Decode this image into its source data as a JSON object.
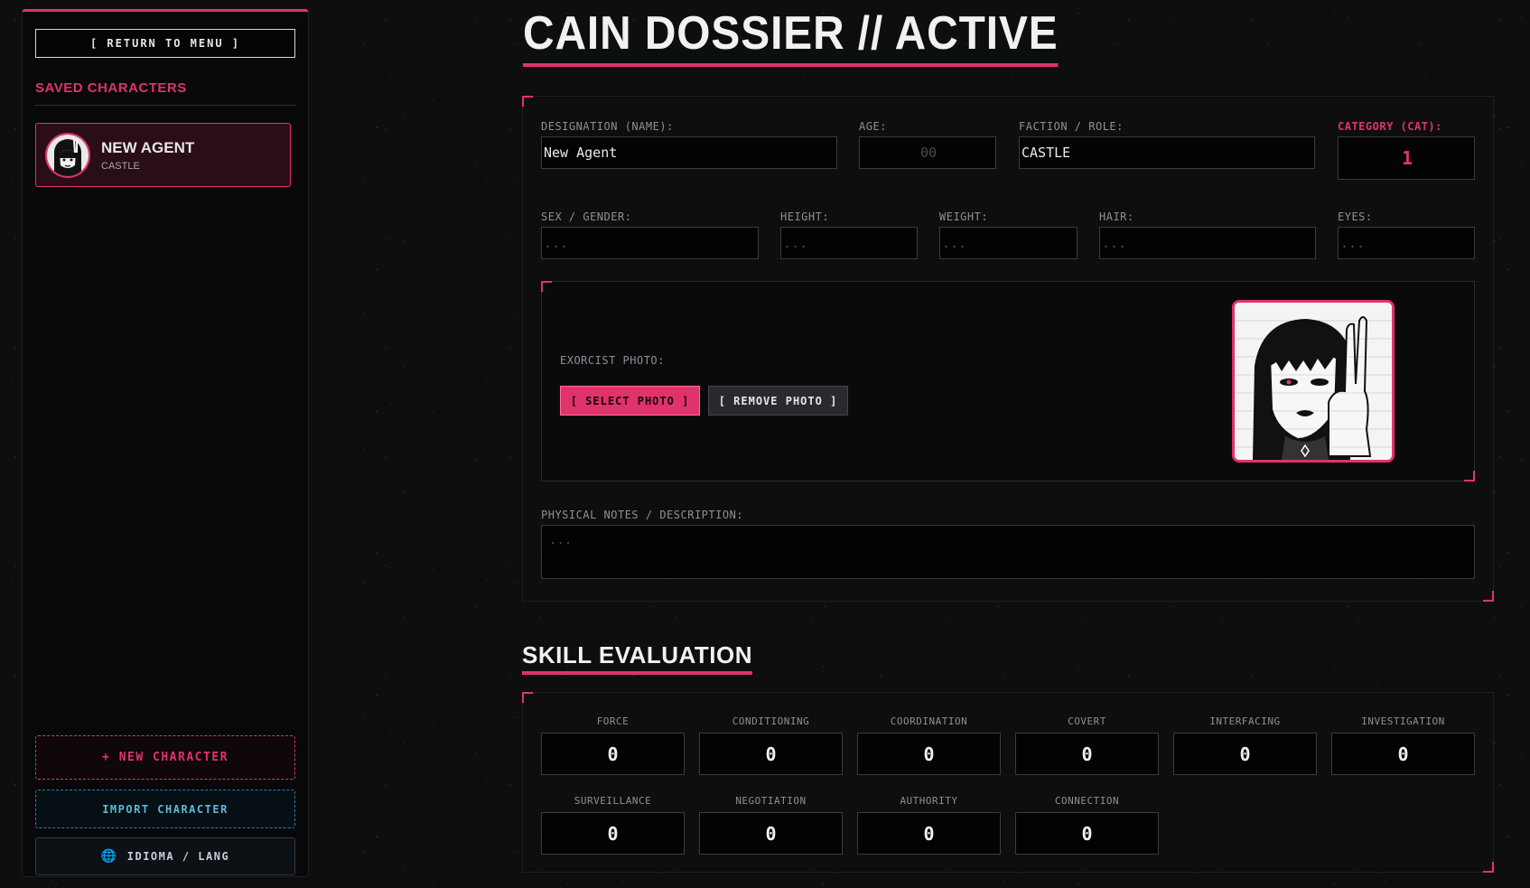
{
  "sidebar": {
    "return_label": "[ RETURN TO MENU ]",
    "saved_title": "SAVED CHARACTERS",
    "characters": [
      {
        "name": "NEW AGENT",
        "faction": "CASTLE"
      }
    ],
    "new_label": "+ NEW CHARACTER",
    "import_label": "IMPORT CHARACTER",
    "lang_label": "IDIOMA / LANG",
    "lang_icon": "globe-icon"
  },
  "header": {
    "title": "CAIN DOSSIER // ACTIVE"
  },
  "dossier": {
    "name_label": "DESIGNATION (NAME):",
    "name_value": "New Agent",
    "age_label": "AGE:",
    "age_placeholder": "00",
    "faction_label": "FACTION / ROLE:",
    "faction_value": "CASTLE",
    "cat_label": "CATEGORY (CAT):",
    "cat_value": "1",
    "sex_label": "SEX / GENDER:",
    "height_label": "HEIGHT:",
    "weight_label": "WEIGHT:",
    "hair_label": "HAIR:",
    "eyes_label": "EYES:",
    "empty_placeholder": "...",
    "photo_label": "EXORCIST PHOTO:",
    "select_photo_label": "[ SELECT PHOTO ]",
    "remove_photo_label": "[ REMOVE PHOTO ]",
    "notes_label": "PHYSICAL NOTES / DESCRIPTION:",
    "notes_placeholder": "..."
  },
  "skills": {
    "title": "SKILL EVALUATION",
    "items": [
      {
        "label": "FORCE",
        "value": "0"
      },
      {
        "label": "CONDITIONING",
        "value": "0"
      },
      {
        "label": "COORDINATION",
        "value": "0"
      },
      {
        "label": "COVERT",
        "value": "0"
      },
      {
        "label": "INTERFACING",
        "value": "0"
      },
      {
        "label": "INVESTIGATION",
        "value": "0"
      },
      {
        "label": "SURVEILLANCE",
        "value": "0"
      },
      {
        "label": "NEGOTIATION",
        "value": "0"
      },
      {
        "label": "AUTHORITY",
        "value": "0"
      },
      {
        "label": "CONNECTION",
        "value": "0"
      }
    ]
  },
  "colors": {
    "accent": "#e0336c",
    "import": "#5fb8d6",
    "background": "#0e0e10"
  }
}
